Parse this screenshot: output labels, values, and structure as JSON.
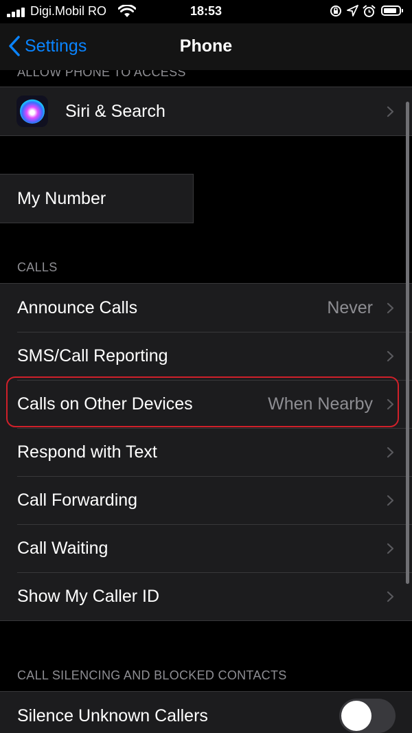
{
  "status_bar": {
    "carrier": "Digi.Mobil RO",
    "time": "18:53",
    "icons": [
      "signal-icon",
      "wifi-icon",
      "orientation-lock-icon",
      "location-icon",
      "alarm-icon",
      "battery-icon"
    ]
  },
  "nav": {
    "back_label": "Settings",
    "title": "Phone"
  },
  "sections": {
    "allow_access": {
      "header": "ALLOW PHONE TO ACCESS",
      "items": [
        {
          "label": "Siri & Search",
          "icon": "siri-icon"
        }
      ]
    },
    "my_number": {
      "label": "My Number"
    },
    "calls": {
      "header": "CALLS",
      "items": [
        {
          "label": "Announce Calls",
          "value": "Never"
        },
        {
          "label": "SMS/Call Reporting",
          "value": ""
        },
        {
          "label": "Calls on Other Devices",
          "value": "When Nearby"
        },
        {
          "label": "Respond with Text",
          "value": ""
        },
        {
          "label": "Call Forwarding",
          "value": ""
        },
        {
          "label": "Call Waiting",
          "value": ""
        },
        {
          "label": "Show My Caller ID",
          "value": ""
        }
      ]
    },
    "silencing": {
      "header": "CALL SILENCING AND BLOCKED CONTACTS",
      "items": [
        {
          "label": "Silence Unknown Callers",
          "toggle": false
        }
      ]
    }
  },
  "colors": {
    "accent": "#0a84ff",
    "background": "#000000",
    "cell_background": "#1c1c1e",
    "secondary_text": "#8e8e93",
    "highlight": "#d0202a"
  }
}
